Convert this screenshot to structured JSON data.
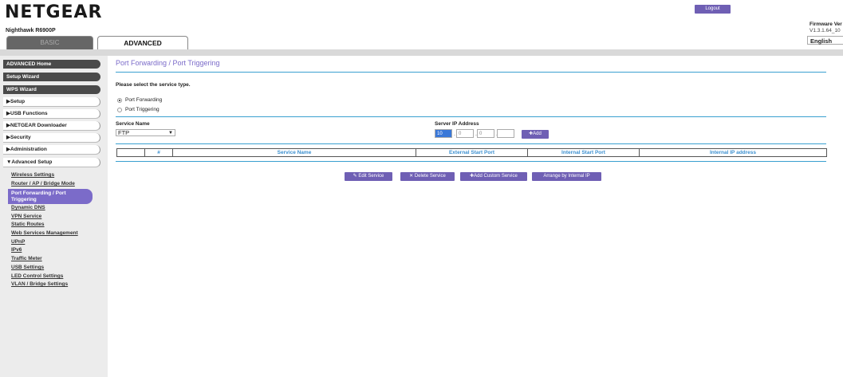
{
  "header": {
    "logo": "NETGEAR",
    "model": "Nighthawk R6900P",
    "logout_label": "Logout",
    "firmware_label": "Firmware Ver",
    "firmware_value": "V1.3.1.64_10",
    "language": "English"
  },
  "tabs": [
    {
      "label": "BASIC",
      "active": false
    },
    {
      "label": "ADVANCED",
      "active": true
    }
  ],
  "sidebar": {
    "primary": [
      "ADVANCED Home",
      "Setup Wizard",
      "WPS Wizard"
    ],
    "sections": [
      "▶Setup",
      "▶USB Functions",
      "▶NETGEAR Downloader",
      "▶Security",
      "▶Administration",
      "▼Advanced Setup"
    ],
    "sub_items": [
      "Wireless Settings",
      "Router / AP / Bridge Mode",
      "Port Forwarding / Port Triggering",
      "Dynamic DNS",
      "VPN Service",
      "Static Routes",
      "Web Services Management",
      "UPnP",
      "IPv6",
      "Traffic Meter",
      "USB Settings",
      "LED Control Settings",
      "VLAN / Bridge Settings"
    ],
    "active_sub": "Port Forwarding / Port Triggering"
  },
  "main": {
    "title": "Port Forwarding / Port Triggering",
    "prompt": "Please select the service type.",
    "radio_forwarding": "Port Forwarding",
    "radio_triggering": "Port Triggering",
    "service_name_label": "Service Name",
    "service_value": "FTP",
    "server_ip_label": "Server IP Address",
    "ip_octets": [
      "10",
      "0",
      "0",
      ""
    ],
    "add_label": "Add",
    "table_headers": [
      "",
      "#",
      "Service Name",
      "External Start Port",
      "Internal Start Port",
      "Internal IP address"
    ],
    "buttons": {
      "edit": "Edit Service",
      "delete": "Delete Service",
      "add_custom": "Add Custom Service",
      "arrange": "Arrange by Internal IP"
    }
  },
  "colors": {
    "accent": "#6f5fb4",
    "rule": "#3aa0d0",
    "header_text": "#3b8fcf"
  }
}
